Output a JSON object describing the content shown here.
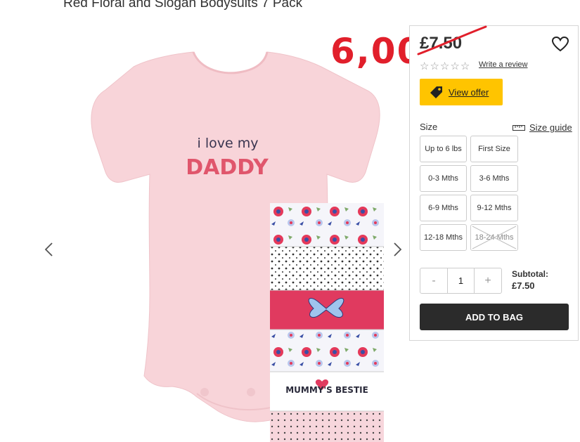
{
  "product": {
    "title": "Red Floral and Slogan Bodysuits 7 Pack",
    "main_image": {
      "garment_color": "#f9d3d8",
      "slogan_line1": "i love my",
      "slogan_line2": "DADDY"
    },
    "pack_image": {
      "card_text": "MUMMY'S BESTIE"
    }
  },
  "annotation": {
    "handwritten_price": "6,00"
  },
  "panel": {
    "price": "£7.50",
    "rating_stars": [
      "☆",
      "☆",
      "☆",
      "☆",
      "☆"
    ],
    "write_review": "Write a review",
    "view_offer": "View offer",
    "size_label": "Size",
    "size_guide": "Size guide",
    "sizes": [
      {
        "label": "Up to 6 lbs",
        "available": true
      },
      {
        "label": "First Size",
        "available": true
      },
      {
        "label": "0-3 Mths",
        "available": true
      },
      {
        "label": "3-6 Mths",
        "available": true
      },
      {
        "label": "6-9 Mths",
        "available": true
      },
      {
        "label": "9-12 Mths",
        "available": true
      },
      {
        "label": "12-18 Mths",
        "available": true
      },
      {
        "label": "18-24 Mths",
        "available": false
      }
    ],
    "quantity": {
      "minus": "-",
      "value": "1",
      "plus": "+"
    },
    "subtotal_label": "Subtotal:",
    "subtotal_value": "£7.50",
    "add_to_bag": "ADD TO BAG"
  },
  "colors": {
    "accent_yellow": "#ffc400",
    "button_dark": "#2b2b2b",
    "annotation_red": "#e11f2b"
  }
}
